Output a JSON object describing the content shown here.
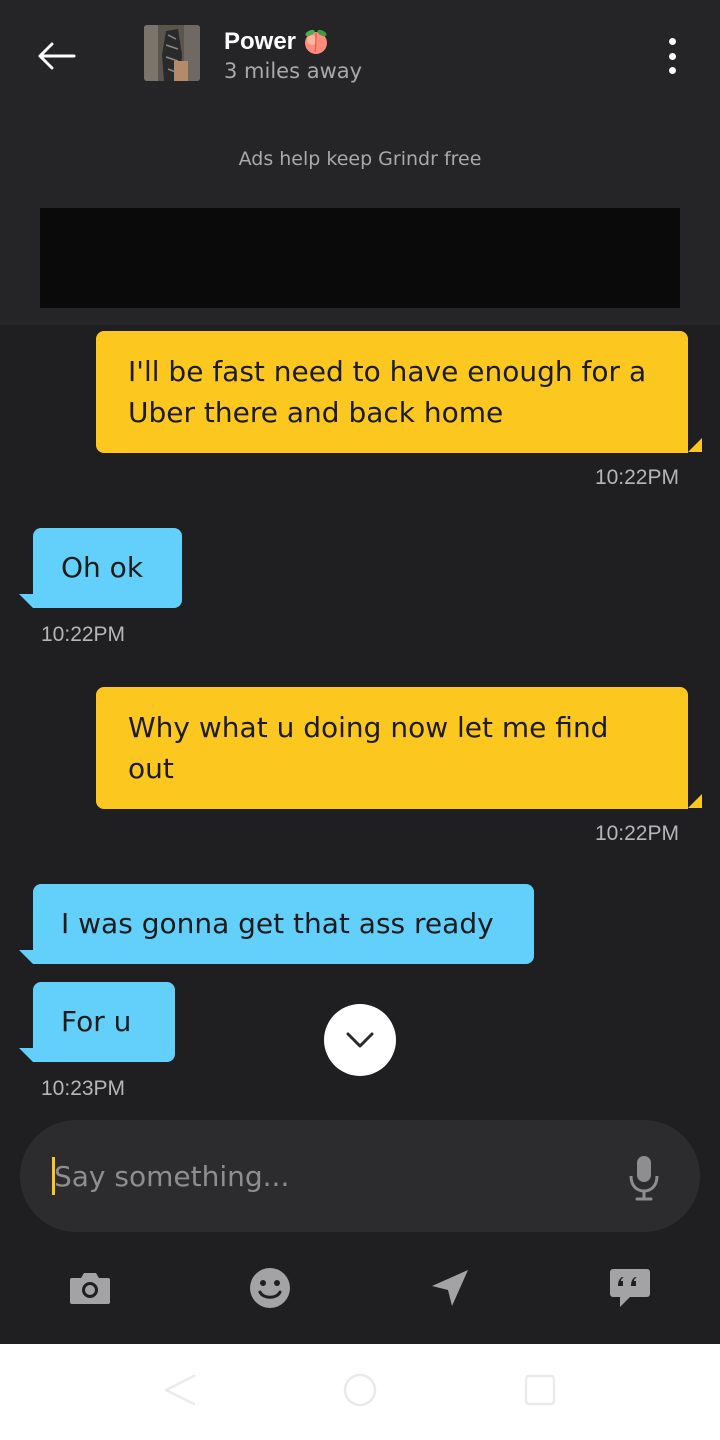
{
  "header": {
    "name": "Power",
    "distance": "3 miles away",
    "ads_text": "Ads help keep Grindr free"
  },
  "messages": [
    {
      "direction": "out",
      "text": "I'll be fast need to have enough for a Uber there and back home",
      "time": "10:22PM"
    },
    {
      "direction": "in",
      "text": "Oh ok",
      "time": "10:22PM"
    },
    {
      "direction": "out",
      "text": "Why what u doing now let me find out",
      "time": "10:22PM"
    },
    {
      "direction": "in",
      "text": "I was gonna get that ass ready",
      "time": ""
    },
    {
      "direction": "in",
      "text": "For u",
      "time": "10:23PM"
    }
  ],
  "input": {
    "placeholder": "Say something..."
  },
  "toolbar": {
    "icons": [
      "camera-icon",
      "emoji-icon",
      "location-icon",
      "saved-phrases-icon"
    ]
  },
  "colors": {
    "background": "#1f1f21",
    "header": "#252527",
    "outgoing_bubble": "#fcc81f",
    "incoming_bubble": "#63cffb",
    "accent": "#fcc81f"
  }
}
